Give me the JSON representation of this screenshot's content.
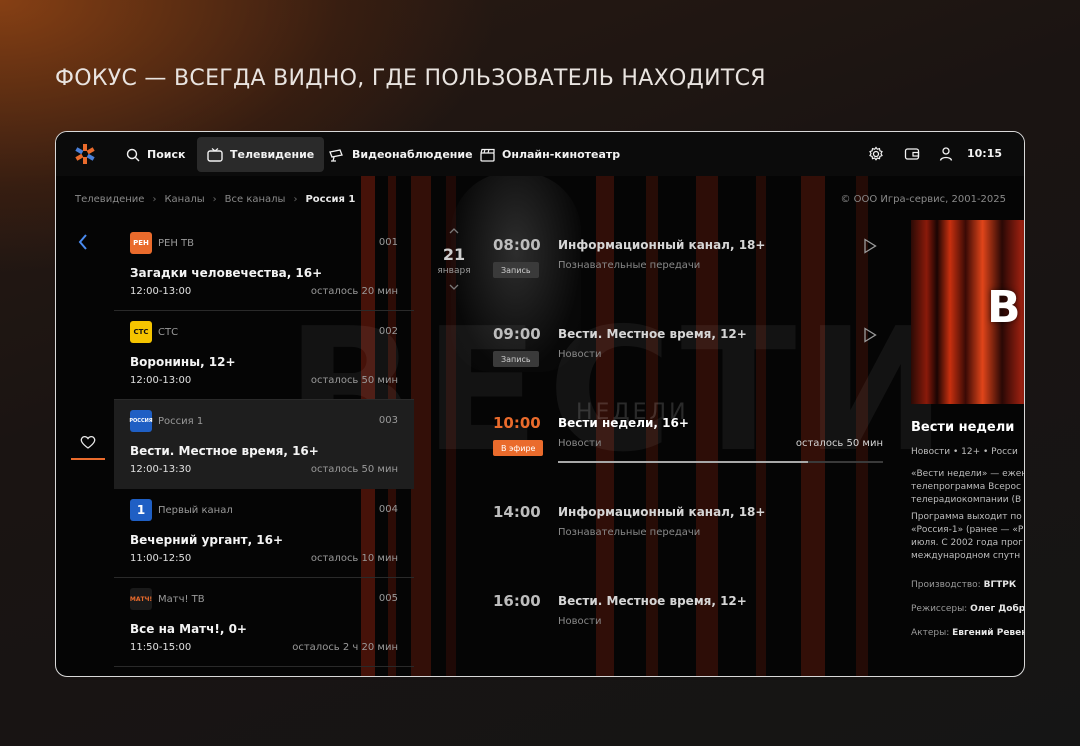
{
  "headline": "ФОКУС — ВСЕГДА ВИДНО, ГДЕ ПОЛЬЗОВАТЕЛЬ НАХОДИТСЯ",
  "nav": {
    "search": "Поиск",
    "tv": "Телевидение",
    "video": "Видеонаблюдение",
    "cinema": "Онлайн-кинотеатр",
    "clock": "10:15"
  },
  "breadcrumb": {
    "items": [
      "Телевидение",
      "Каналы",
      "Все каналы"
    ],
    "current": "Россия 1"
  },
  "copyright": "© ООО Игра-сервис, 2001-2025",
  "date": {
    "day": "21",
    "month": "января"
  },
  "channels": [
    {
      "logo": "РЕН",
      "name": "РЕН ТВ",
      "number": "001",
      "program": "Загадки человечества, 16+",
      "time": "12:00-13:00",
      "remaining": "осталось 20 мин",
      "logo_color": "#ea6b2c"
    },
    {
      "logo": "СТС",
      "name": "СТС",
      "number": "002",
      "program": "Воронины, 12+",
      "time": "12:00-13:00",
      "remaining": "осталось 50 мин",
      "logo_color": "#f5c400"
    },
    {
      "logo": "РОССИЯ",
      "name": "Россия 1",
      "number": "003",
      "program": "Вести. Местное время, 16+",
      "time": "12:00-13:30",
      "remaining": "осталось 50 мин",
      "logo_color": "#1f5fc4"
    },
    {
      "logo": "1",
      "name": "Первый канал",
      "number": "004",
      "program": "Вечерний ургант, 16+",
      "time": "11:00-12:50",
      "remaining": "осталось 10 мин",
      "logo_color": "#1f5fc4"
    },
    {
      "logo": "МАТЧ!",
      "name": "Матч! ТВ",
      "number": "005",
      "program": "Все на Матч!, 0+",
      "time": "11:50-15:00",
      "remaining": "осталось 2 ч 20 мин",
      "logo_color": "#1a1a1a"
    }
  ],
  "schedule": [
    {
      "time": "08:00",
      "title": "Информационный канал, 18+",
      "genre": "Познавательные передачи",
      "badge": "Запись"
    },
    {
      "time": "09:00",
      "title": "Вести. Местное время, 12+",
      "genre": "Новости",
      "badge": "Запись"
    },
    {
      "time": "10:00",
      "title": "Вести недели, 16+",
      "genre": "Новости",
      "badge": "В эфире",
      "remaining": "осталось  50 мин",
      "progress": 0.77
    },
    {
      "time": "14:00",
      "title": "Информационный канал, 18+",
      "genre": "Познавательные передачи"
    },
    {
      "time": "16:00",
      "title": "Вести. Местное время, 12+",
      "genre": "Новости"
    }
  ],
  "background_text": {
    "big": "ВЕСТИ",
    "small": "НЕДЕЛИ"
  },
  "detail": {
    "poster_text": "В",
    "title": "Вести недели",
    "meta": "Новости  •  12+  •  Росси",
    "desc": [
      "«Вести недели» — ежен",
      "телепрограмма Всерос",
      "телерадиокомпании (В",
      "Программа выходит по",
      "«Россия-1» (ранее — «Р",
      "июля. С 2002 года прог",
      "международном спутн"
    ],
    "production_label": "Производство:",
    "production": "ВГТРК",
    "directors_label": "Режиссеры:",
    "directors": "Олег Добр",
    "actors_label": "Актеры:",
    "actors": "Евгений Ревен"
  },
  "colors": {
    "accent": "#ea6b2c",
    "frame_border": "#d9d9d9",
    "focus_bg": "#1e1e1e"
  }
}
